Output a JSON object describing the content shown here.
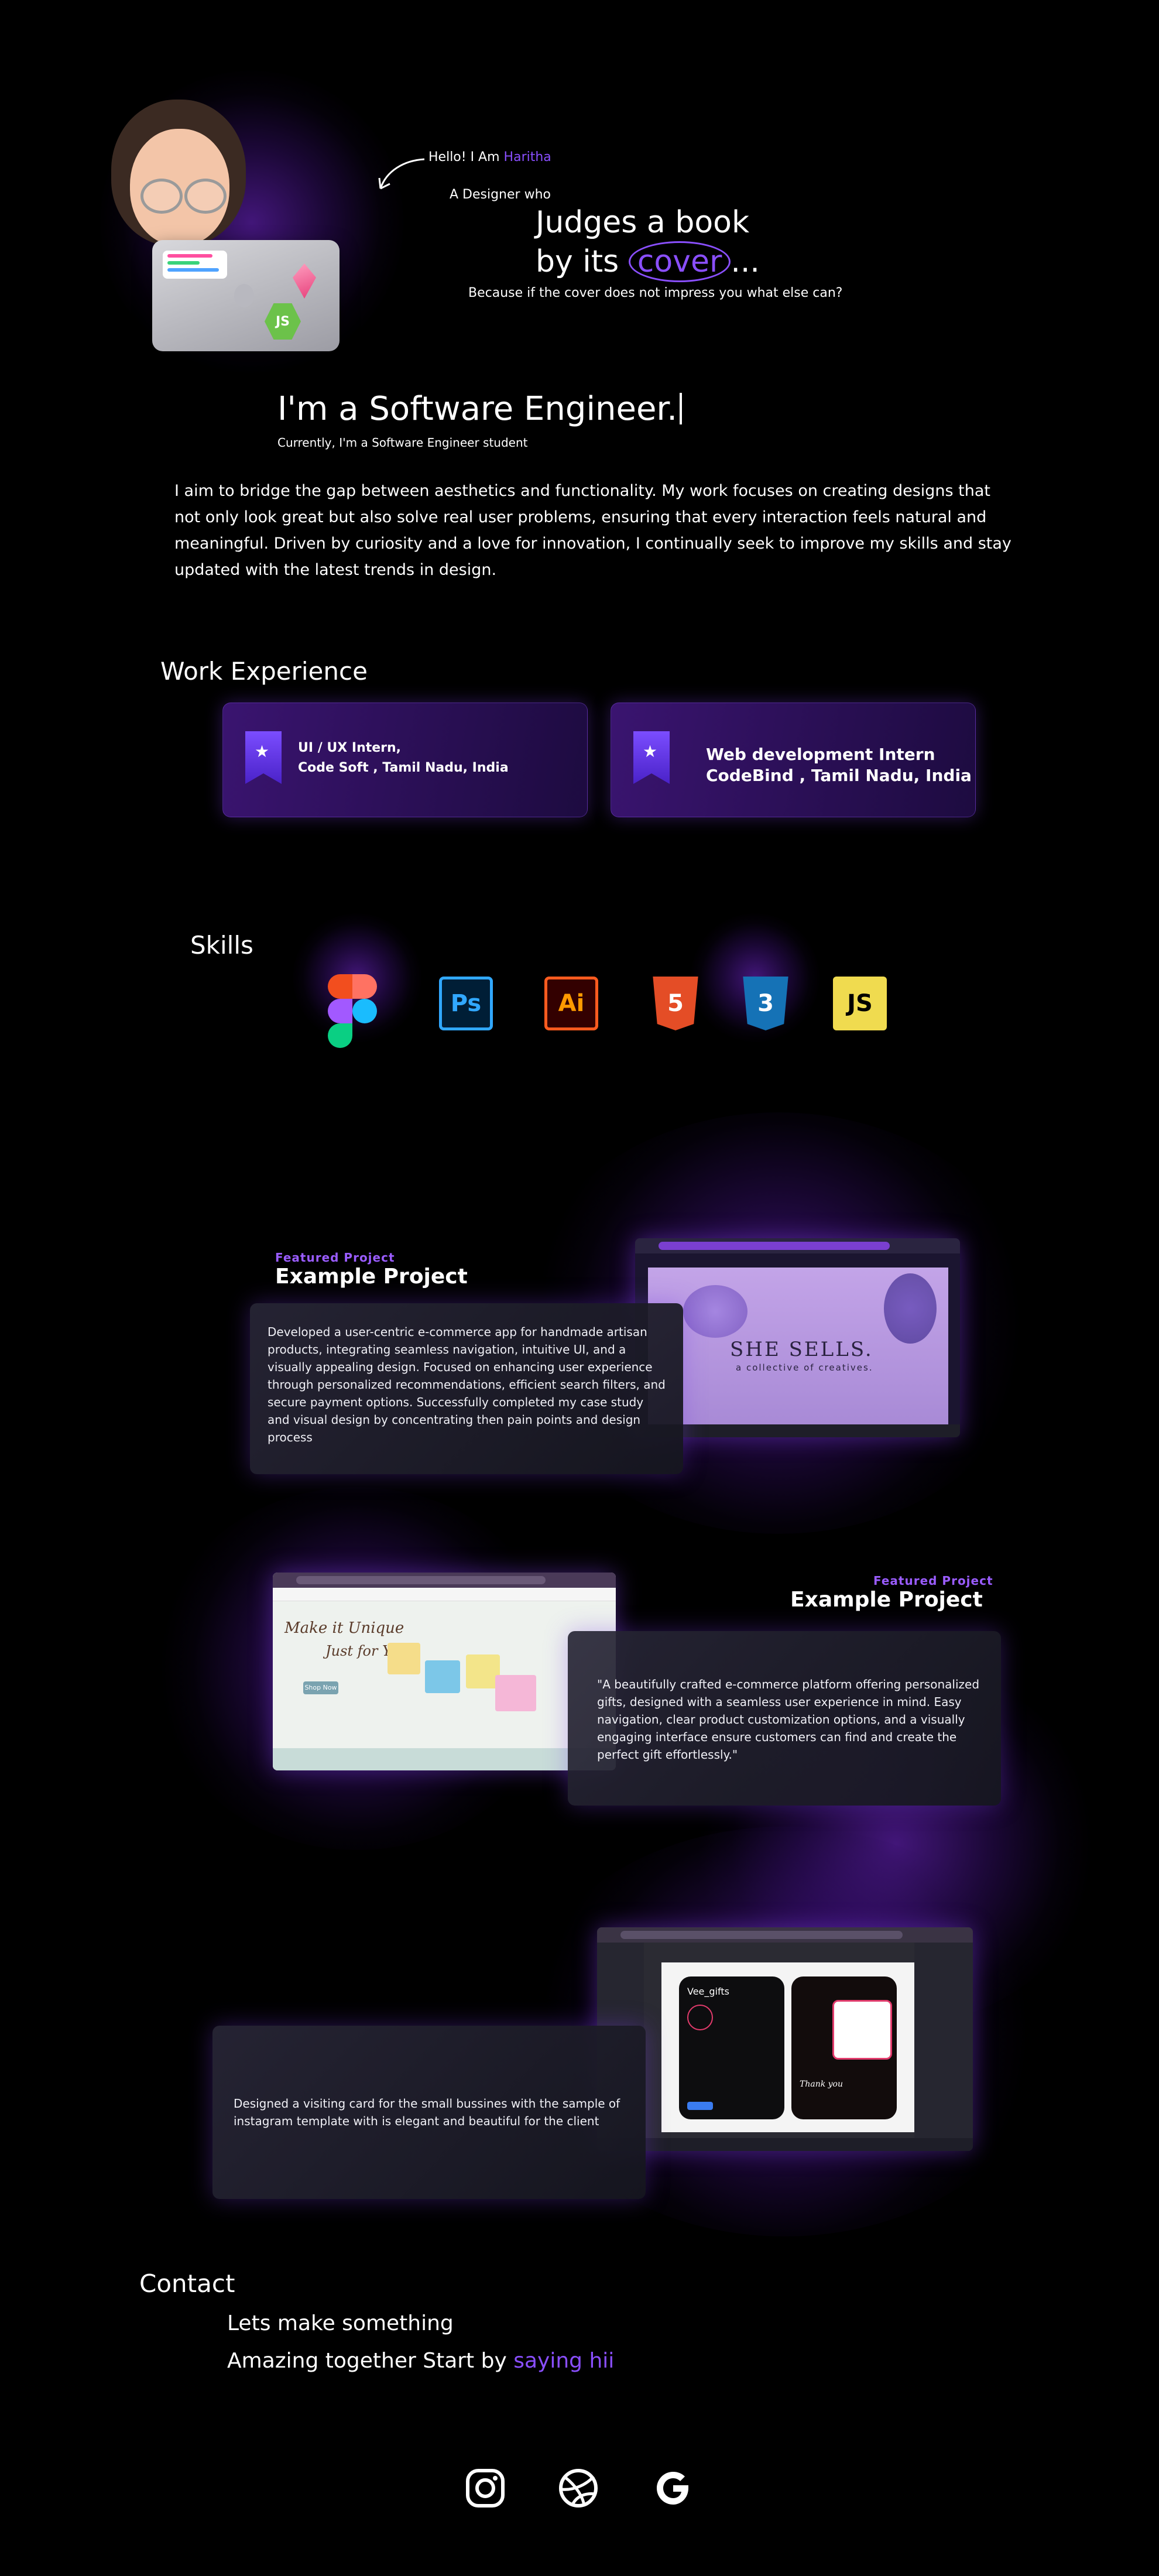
{
  "hero": {
    "greeting": "Hello! I Am",
    "name": "Haritha",
    "designer_who": "A Designer who",
    "headline_line1": "Judges a book",
    "headline_prefix": "by its",
    "headline_highlight": "cover",
    "headline_suffix": "...",
    "subtitle": "Because if the cover does not impress you what else can?",
    "role": "I'm a Software Engineer.",
    "currently": "Currently, I'm a Software Engineer student",
    "bio": "I aim to bridge the gap between aesthetics and functionality. My work focuses on creating designs that not only look great but also solve real user problems, ensuring that every interaction feels natural and meaningful. Driven by curiosity and a love for innovation, I continually seek to improve my skills and stay updated with the latest trends in design."
  },
  "work": {
    "title": "Work Experience",
    "items": [
      {
        "role": "UI / UX Intern,",
        "company": "Code Soft , Tamil Nadu, India"
      },
      {
        "role": "Web development Intern",
        "company": "CodeBind , Tamil Nadu, India"
      }
    ]
  },
  "skills": {
    "title": "Skills",
    "items": [
      {
        "icon": "figma-icon",
        "label": ""
      },
      {
        "icon": "photoshop-icon",
        "label": "Ps"
      },
      {
        "icon": "illustrator-icon",
        "label": "Ai"
      },
      {
        "icon": "html5-icon",
        "label": "5"
      },
      {
        "icon": "css3-icon",
        "label": "3"
      },
      {
        "icon": "javascript-icon",
        "label": "JS"
      }
    ]
  },
  "projects": [
    {
      "featured": "Featured Project",
      "title": "Example Project",
      "description": "Developed a user-centric e-commerce app for handmade artisan products, integrating seamless navigation, intuitive UI, and a visually appealing design. Focused on enhancing user experience through personalized recommendations, efficient search filters, and secure payment options. Successfully completed my case study and visual design by concentrating then pain points and design process",
      "screenshot_brand": "SHE SELLS.",
      "screenshot_tagline": "a collective of creatives."
    },
    {
      "featured": "Featured Project",
      "title": "Example Project",
      "description": "\"A beautifully crafted e-commerce platform offering personalized gifts, designed with a seamless user experience in mind. Easy navigation, clear product customization options, and a visually engaging interface ensure customers can find and create the perfect gift effortlessly.\"",
      "screenshot_heading1": "Make it Unique",
      "screenshot_heading2": "Just for You",
      "screenshot_button": "Shop Now"
    },
    {
      "description": "Designed a visiting card for the small bussines with the sample of instagram template with is elegant and beautiful for the client",
      "screenshot_handle": "Vee_gifts",
      "screenshot_thanks": "Thank you"
    }
  ],
  "contact": {
    "title": "Contact",
    "line1": "Lets make something",
    "line2_prefix": "Amazing together  Start by",
    "line2_link": "saying hii"
  },
  "social": [
    {
      "icon": "instagram-icon"
    },
    {
      "icon": "dribbble-icon"
    },
    {
      "icon": "google-icon"
    }
  ],
  "colors": {
    "accent": "#8a4fff",
    "background": "#000000",
    "card_purple": "#2a0f55"
  }
}
